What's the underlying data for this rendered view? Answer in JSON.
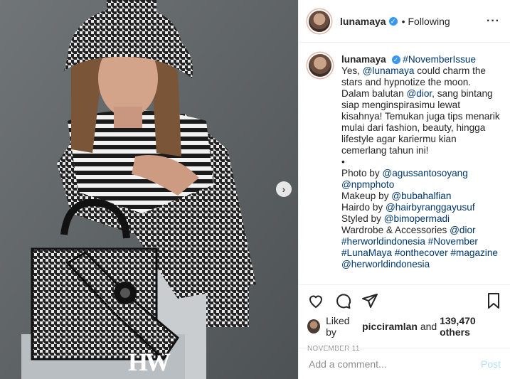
{
  "header": {
    "username": "lunamaya",
    "verified": true,
    "dot": "•",
    "follow_state": "Following",
    "more_icon": "more-horizontal-icon"
  },
  "caption": {
    "username": "lunamaya",
    "hashtag": "#NovemberIssue",
    "line1a": "Yes, ",
    "mention1": "@lunamaya",
    "line1b": " could charm the stars and hypnotize the moon. Dalam balutan ",
    "mention2": "@dior",
    "line1c": ", sang bintang siap menginspirasimu lewat kisahnya! Temukan juga tips menarik mulai dari fashion, beauty, hingga lifestyle agar kariermu kian cemerlang tahun ini!",
    "bullet": "•",
    "photo_label": "Photo by ",
    "photo_1": "@agussantosoyang",
    "photo_2": "@npmphoto",
    "makeup_label": "Makeup by ",
    "makeup": "@bubahalfian",
    "hair_label": "Hairdo by ",
    "hair": "@hairbyranggayusuf",
    "style_label": "Styled by ",
    "style": "@bimopermadi",
    "wardrobe_label": "Wardrobe & Accessories ",
    "wardrobe": "@dior",
    "tag1": "#herworldindonesia",
    "tag2": "#November",
    "tag3": "#LunaMaya",
    "tag4": "#onthecover",
    "tag5": "#magazine",
    "tag6": "@herworldindonesia"
  },
  "actions": {
    "like_icon": "heart-icon",
    "comment_icon": "comment-icon",
    "share_icon": "paper-plane-icon",
    "save_icon": "bookmark-icon"
  },
  "likes": {
    "prefix": "Liked by ",
    "user": "picciramlan",
    "middle": " and ",
    "others": "139,470 others"
  },
  "date": "NOVEMBER 11",
  "comment_box": {
    "placeholder": "Add a comment...",
    "post_label": "Post"
  },
  "media": {
    "next_icon": "chevron-right-icon",
    "watermark": "HW"
  },
  "colors": {
    "link": "#00376b",
    "verified": "#3897f0",
    "muted": "#8e8e8e"
  }
}
